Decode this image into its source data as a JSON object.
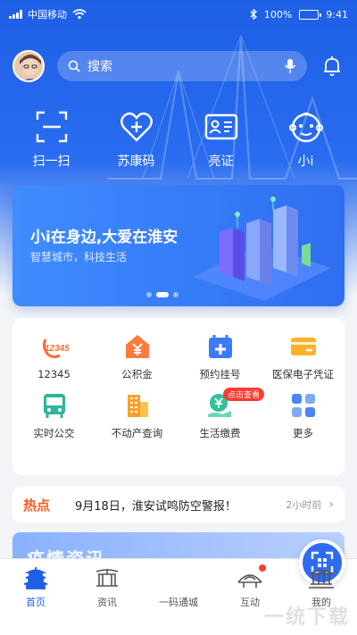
{
  "status": {
    "carrier": "中国移动",
    "battery": "100%",
    "time": "9:41"
  },
  "header": {
    "search_placeholder": "搜索"
  },
  "quick": [
    {
      "label": "扫一扫",
      "icon": "scan-icon"
    },
    {
      "label": "苏康码",
      "icon": "health-heart-icon"
    },
    {
      "label": "亮证",
      "icon": "id-card-icon"
    },
    {
      "label": "小i",
      "icon": "robot-icon"
    }
  ],
  "banner": {
    "title": "小i在身边,大爱在淮安",
    "subtitle": "智慧城市，科技生活"
  },
  "services": [
    {
      "label": "12345",
      "icon": "hotline-12345-icon"
    },
    {
      "label": "公积金",
      "icon": "housing-fund-icon"
    },
    {
      "label": "预约挂号",
      "icon": "appointment-icon"
    },
    {
      "label": "医保电子凭证",
      "icon": "medical-card-icon"
    },
    {
      "label": "实时公交",
      "icon": "bus-icon"
    },
    {
      "label": "不动产查询",
      "icon": "building-icon"
    },
    {
      "label": "生活缴费",
      "icon": "payment-icon",
      "tag": "点击查看"
    },
    {
      "label": "更多",
      "icon": "more-grid-icon"
    }
  ],
  "hot": {
    "badge": "热点",
    "text": "9月18日，淮安试鸣防空警报！",
    "time": "2小时前"
  },
  "epidemic": {
    "title": "疫情资讯"
  },
  "tabs": [
    {
      "label": "首页",
      "icon": "home-pagoda-icon"
    },
    {
      "label": "资讯",
      "icon": "news-icon"
    },
    {
      "label": "一码通城",
      "icon": "qr-code-icon"
    },
    {
      "label": "互动",
      "icon": "bridge-icon"
    },
    {
      "label": "我的",
      "icon": "pavilion-icon"
    }
  ],
  "watermark": "一统下载"
}
